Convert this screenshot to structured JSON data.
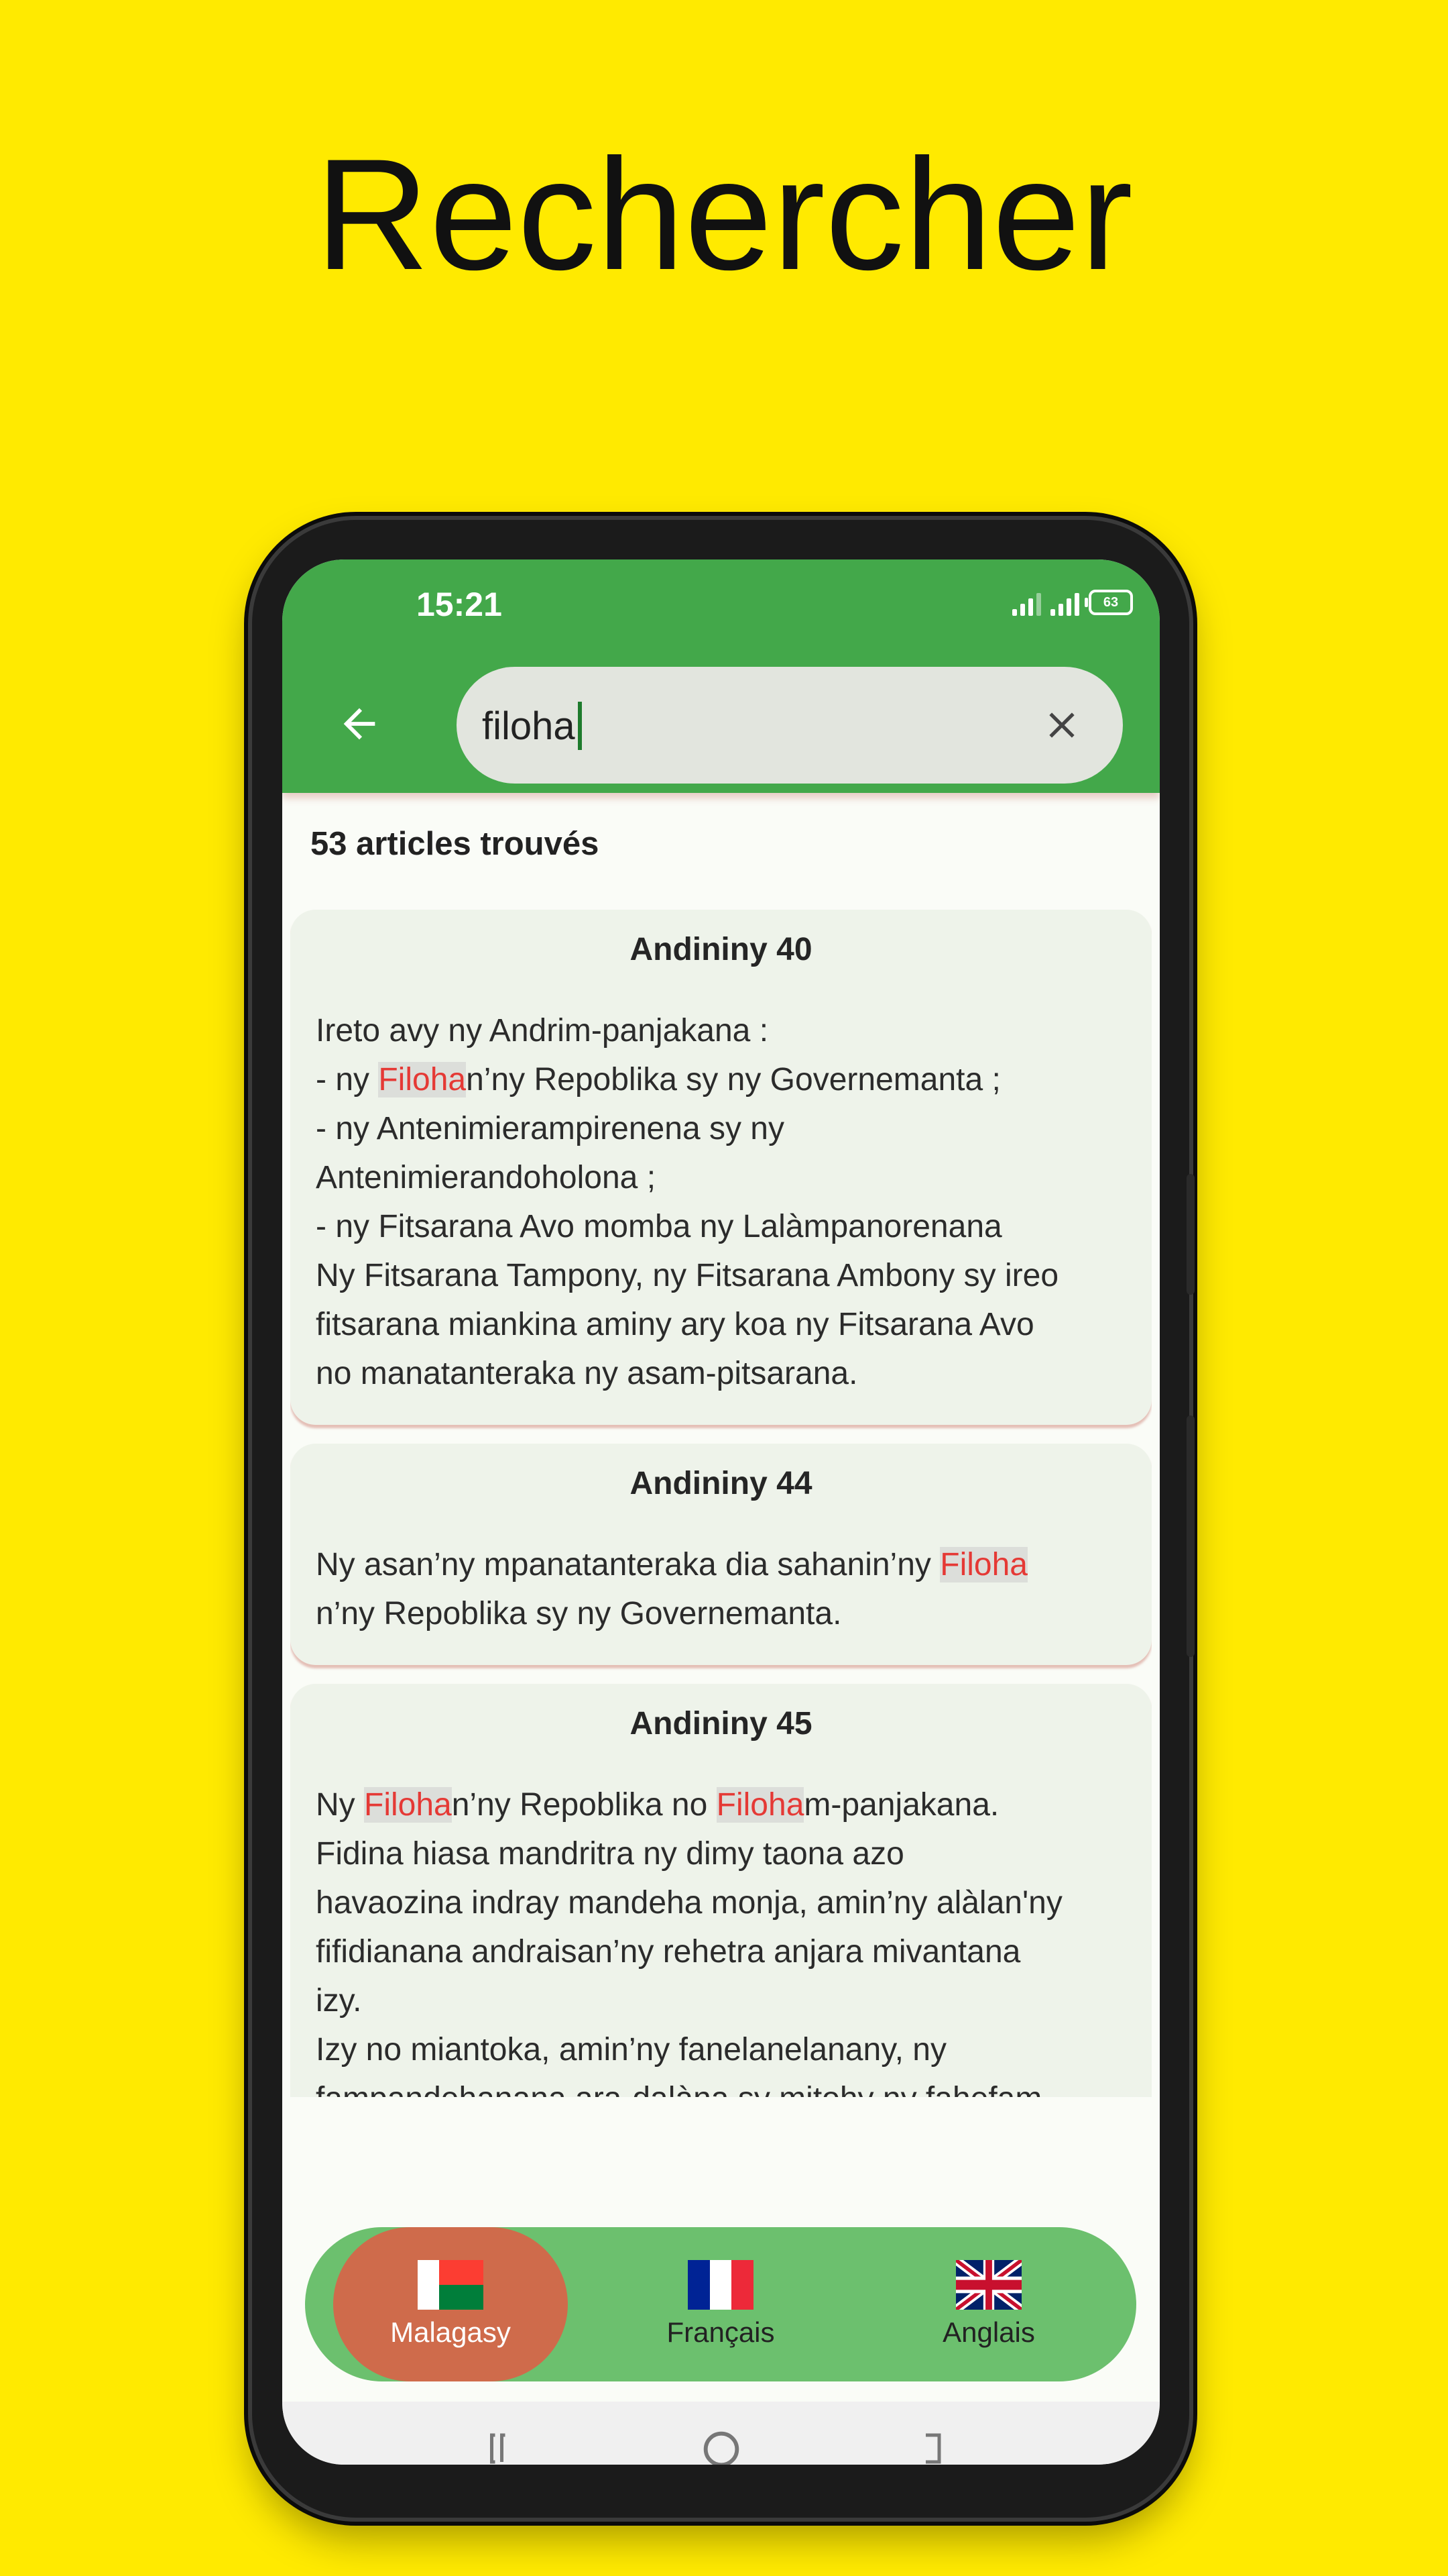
{
  "promo": {
    "title": "Rechercher"
  },
  "status_bar": {
    "time": "15:21",
    "battery": "63"
  },
  "search": {
    "query": "filoha"
  },
  "results": {
    "count_label": "53 articles trouvés",
    "articles": [
      {
        "title": "Andininy 40",
        "segments": [
          {
            "t": "Ireto avy ny Andrim-panjakana :\n- ny "
          },
          {
            "t": "Filoha",
            "hl": true
          },
          {
            "t": "n’ny Repoblika sy ny Governemanta ;\n- ny Antenimierampirenena sy ny\nAntenimierandoholona ;\n- ny Fitsarana Avo momba ny Lalàmpanorenana\nNy Fitsarana Tampony, ny Fitsarana Ambony sy ireo\nfitsarana miankina aminy ary koa ny Fitsarana Avo\nno manatanteraka ny asam-pitsarana."
          }
        ]
      },
      {
        "title": "Andininy 44",
        "segments": [
          {
            "t": "Ny asan’ny mpanatanteraka dia sahanin’ny "
          },
          {
            "t": "Filoha",
            "hl": true
          },
          {
            "t": "\nn’ny Repoblika sy ny Governemanta."
          }
        ]
      },
      {
        "title": "Andininy 45",
        "segments": [
          {
            "t": "Ny "
          },
          {
            "t": "Filoha",
            "hl": true
          },
          {
            "t": "n’ny Repoblika no "
          },
          {
            "t": "Filoha",
            "hl": true
          },
          {
            "t": "m-panjakana.\nFidina hiasa mandritra ny dimy taona azo\nhavaozina indray mandeha monja, amin’ny alàlan'ny\nfifidianana andraisan’ny rehetra anjara mivantana\nizy.\nIzy no miantoka, amin’ny fanelanelanany, ny\nfampandehanana ara-dalàna sy mitohy ny fahefam-\npanjakana, ny fahaleovantenam-pirenena sy ny\nmaha iray tsy anombinana ny tanindrazana. Izy no"
          }
        ]
      }
    ]
  },
  "bottom_nav": {
    "items": [
      {
        "label": "Malagasy",
        "active": true
      },
      {
        "label": "Français",
        "active": false
      },
      {
        "label": "Anglais",
        "active": false
      }
    ]
  },
  "colors": {
    "background": "#FFEA00",
    "app_bar": "#43A84A",
    "nav_bar": "#6CC06E",
    "active_tab": "#CF6B4B",
    "highlight": "#E53935"
  }
}
